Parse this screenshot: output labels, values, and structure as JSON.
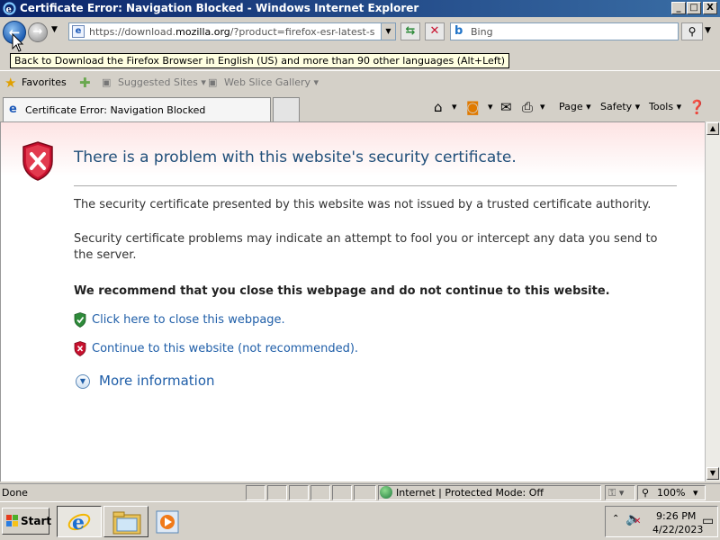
{
  "window": {
    "title": "Certificate Error: Navigation Blocked - Windows Internet Explorer",
    "min": "_",
    "max": "□",
    "close": "X"
  },
  "nav": {
    "url_prefix": "https://download.",
    "url_domain": "mozilla.org",
    "url_suffix": "/?product=firefox-esr-latest-ssl&os=w",
    "search_placeholder": "Bing",
    "tooltip": "Back to Download the Firefox Browser in English (US) and more than 90 other languages (Alt+Left)"
  },
  "favorites": {
    "favorites_label": "Favorites",
    "suggested_sites": "Suggested Sites ▾",
    "web_slice_gallery": "Web Slice Gallery ▾"
  },
  "tabs": [
    {
      "label": "Certificate Error: Navigation Blocked"
    }
  ],
  "commands": {
    "page": "Page ▾",
    "safety": "Safety ▾",
    "tools": "Tools ▾"
  },
  "content": {
    "headline": "There is a problem with this website's security certificate.",
    "para1": "The security certificate presented by this website was not issued by a trusted certificate authority.",
    "para2": "Security certificate problems may indicate an attempt to fool you or intercept any data you send to the server.",
    "recommend": "We recommend that you close this webpage and do not continue to this website.",
    "close_link": "Click here to close this webpage.",
    "continue_link": "Continue to this website (not recommended).",
    "more_info": "More information"
  },
  "status": {
    "text": "Done",
    "zone": "Internet | Protected Mode: Off",
    "zoom": "100%"
  },
  "taskbar": {
    "start_label": "Start",
    "time": "9:26 PM",
    "date": "4/22/2023"
  },
  "colors": {
    "title_gradient_start": "#0a246a",
    "title_gradient_end": "#3a6ea5",
    "headline": "#1f4e79",
    "link": "#1f5ea8",
    "error_red": "#c8102e",
    "ok_green": "#2e8b3a"
  }
}
